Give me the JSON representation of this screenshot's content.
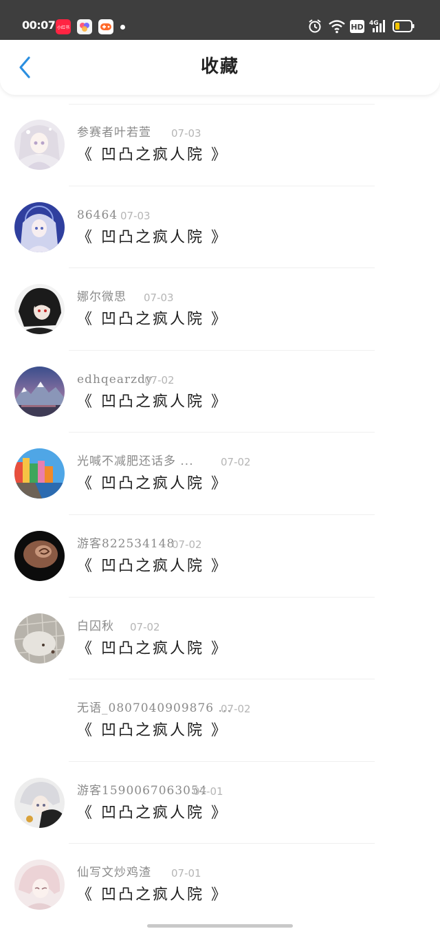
{
  "status_bar": {
    "time": "00:07",
    "app_icons": [
      "xiaohongshu-app-icon",
      "photo-app-icon",
      "game-app-icon"
    ],
    "right_icons": [
      "alarm-icon",
      "wifi-icon",
      "hd-icon",
      "4g-signal-icon",
      "battery-icon"
    ],
    "hd_label": "HD",
    "network_label": "4G"
  },
  "header": {
    "title": "收藏",
    "back_icon": "chevron-left-icon",
    "accent_color": "#2b8fe0"
  },
  "favorites": [
    {
      "name": "参赛者叶若萱",
      "date": "07-03",
      "book": "《 凹凸之疯人院 》",
      "avatar": "anime-girl-white-hair"
    },
    {
      "name": "86464",
      "date": "07-03",
      "book": "《 凹凸之疯人院 》",
      "avatar": "anime-girl-blue-background"
    },
    {
      "name": "娜尔微思",
      "date": "07-03",
      "book": "《 凹凸之疯人院 》",
      "avatar": "anime-boy-black-hair"
    },
    {
      "name": "edhqearzdy",
      "date": "07-02",
      "book": "《 凹凸之疯人院 》",
      "avatar": "snowy-mountain-landscape"
    },
    {
      "name": "光喊不减肥还话多 ...",
      "date": "07-02",
      "book": "《 凹凸之疯人院 》",
      "avatar": "colorful-coastal-town"
    },
    {
      "name": "游客822534148",
      "date": "07-02",
      "book": "《 凹凸之疯人院 》",
      "avatar": "dark-shell"
    },
    {
      "name": "白囚秋",
      "date": "07-02",
      "book": "《 凹凸之疯人院 》",
      "avatar": "white-animal-photo"
    },
    {
      "name": "无语_0807040909876 ...",
      "date": "07-02",
      "book": "《 凹凸之疯人院 》",
      "avatar": "none"
    },
    {
      "name": "游客1590067063054",
      "date": "07-01",
      "book": "《 凹凸之疯人院 》",
      "avatar": "anime-boy-silver-hair"
    },
    {
      "name": "仙写文炒鸡渣",
      "date": "07-01",
      "book": "《 凹凸之疯人院 》",
      "avatar": "anime-girl-pink-hair"
    }
  ]
}
